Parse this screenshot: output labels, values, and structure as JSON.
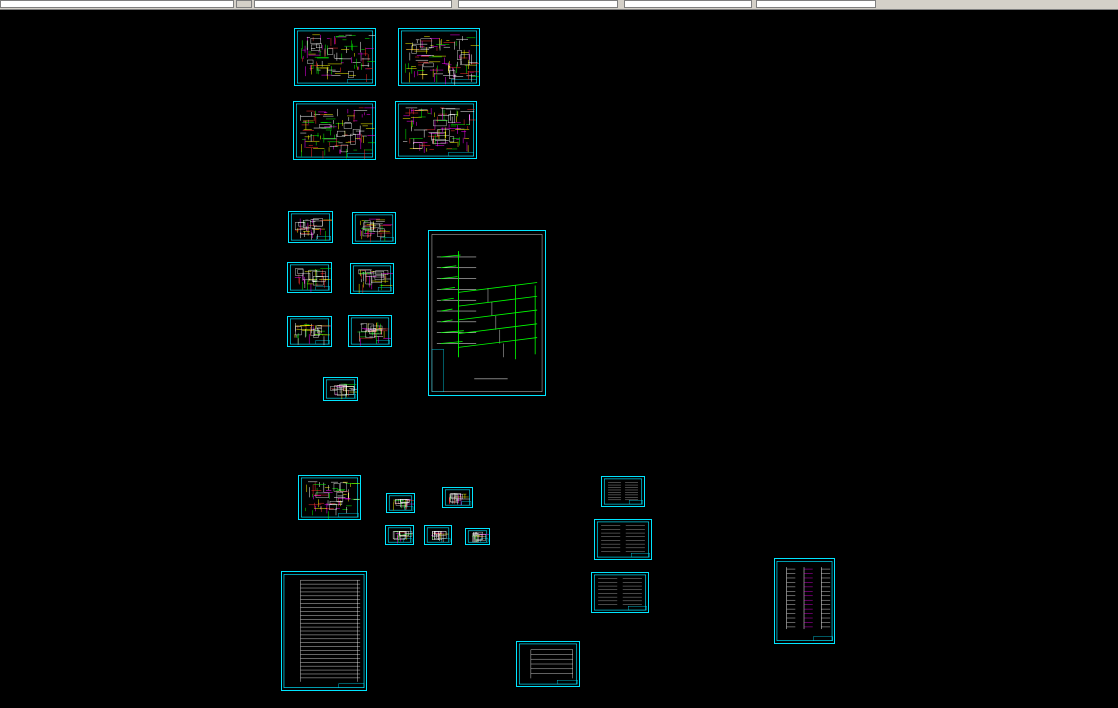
{
  "app": {
    "viewport": "cad-model-space",
    "background_color": "#000000"
  },
  "colors": {
    "frame": "#00e5ff",
    "wall": "#ffffff",
    "pipe_green": "#00ff00",
    "pipe_magenta": "#ff00ff",
    "pipe_yellow": "#ffff00",
    "pipe_red": "#ff3030"
  },
  "toolbar": {
    "fields": [
      "",
      "",
      "",
      "",
      ""
    ]
  },
  "drawing_sheets": [
    {
      "id": "plan-1",
      "kind": "floor-plan"
    },
    {
      "id": "plan-2",
      "kind": "floor-plan"
    },
    {
      "id": "plan-3",
      "kind": "floor-plan"
    },
    {
      "id": "plan-4",
      "kind": "floor-plan"
    },
    {
      "id": "small-plan-1",
      "kind": "floor-plan"
    },
    {
      "id": "small-plan-2",
      "kind": "floor-plan"
    },
    {
      "id": "small-plan-3",
      "kind": "floor-plan"
    },
    {
      "id": "small-plan-4",
      "kind": "floor-plan"
    },
    {
      "id": "small-plan-5",
      "kind": "floor-plan"
    },
    {
      "id": "small-plan-6",
      "kind": "floor-plan"
    },
    {
      "id": "detail-1",
      "kind": "detail"
    },
    {
      "id": "riser-diagram",
      "kind": "riser-diagram"
    },
    {
      "id": "site-plan",
      "kind": "site-plan"
    },
    {
      "id": "detail-2",
      "kind": "detail"
    },
    {
      "id": "detail-3",
      "kind": "detail"
    },
    {
      "id": "detail-4",
      "kind": "detail"
    },
    {
      "id": "detail-5",
      "kind": "detail"
    },
    {
      "id": "detail-6",
      "kind": "detail"
    },
    {
      "id": "notes-1",
      "kind": "notes-table"
    },
    {
      "id": "notes-2",
      "kind": "notes-table"
    },
    {
      "id": "notes-3",
      "kind": "notes-table"
    },
    {
      "id": "schedule-table",
      "kind": "schedule-table"
    },
    {
      "id": "legend-sheet",
      "kind": "legend"
    },
    {
      "id": "system-diagram",
      "kind": "system-diagram"
    }
  ]
}
